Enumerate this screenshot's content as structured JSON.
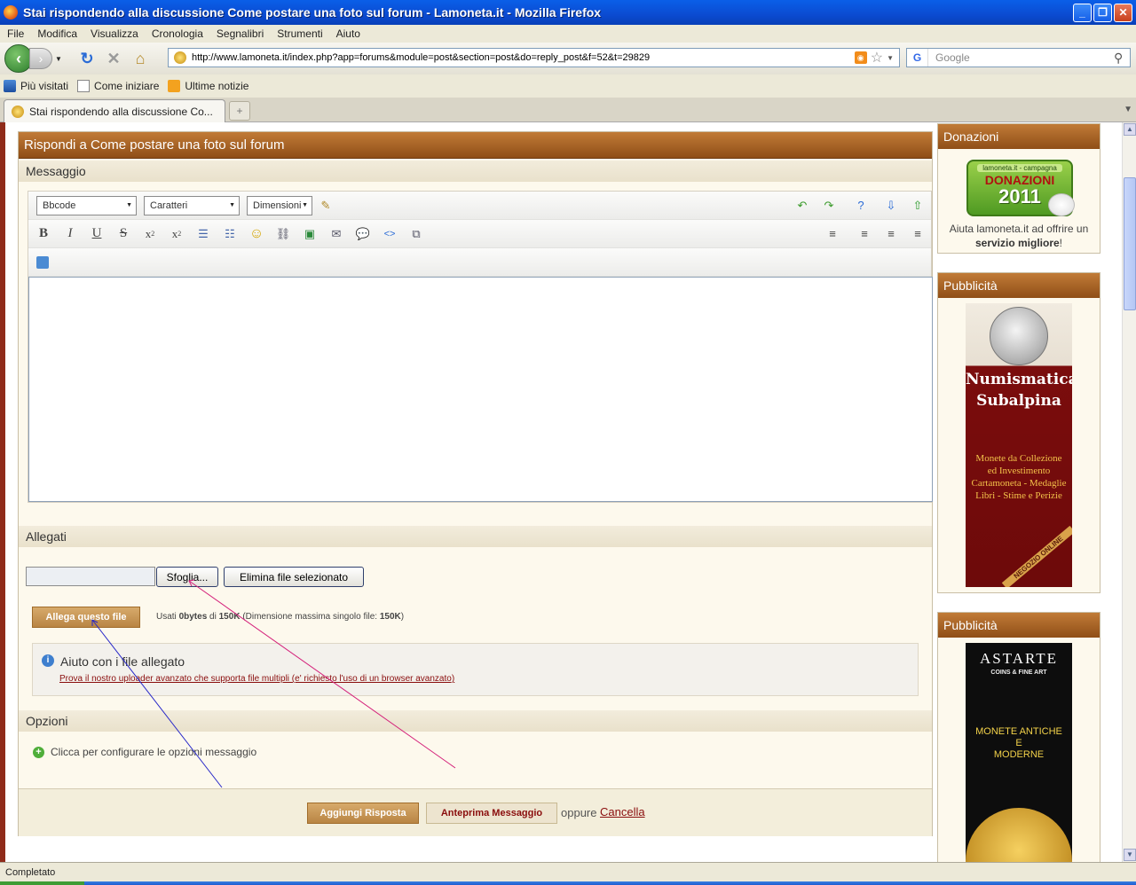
{
  "window": {
    "title": "Stai rispondendo alla discussione Come postare una foto sul forum - Lamoneta.it - Mozilla Firefox"
  },
  "menu": [
    "File",
    "Modifica",
    "Visualizza",
    "Cronologia",
    "Segnalibri",
    "Strumenti",
    "Aiuto"
  ],
  "nav": {
    "url": "http://www.lamoneta.it/index.php?app=forums&module=post&section=post&do=reply_post&f=52&t=29829",
    "search_placeholder": "Google"
  },
  "bookmarks": [
    "Più visitati",
    "Come iniziare",
    "Ultime notizie"
  ],
  "tab": {
    "label": "Stai rispondendo alla discussione Co..."
  },
  "main": {
    "header": "Rispondi a Come postare una foto sul forum",
    "message_section": "Messaggio",
    "editor": {
      "select_bbcode": "Bbcode",
      "select_font": "Caratteri",
      "select_size": "Dimensioni"
    },
    "attachments_section": "Allegati",
    "browse_button": "Sfoglia...",
    "remove_file_button": "Elimina file selezionato",
    "attach_button": "Allega questo file",
    "usage": {
      "prefix": "Usati",
      "used": "0bytes",
      "of": "di",
      "total": "150K",
      "max_label": "(Dimensione massima singolo file:",
      "max": "150K",
      "close": ")"
    },
    "help": {
      "title": "Aiuto con i file allegato",
      "link": "Prova il nostro uploader avanzato che supporta file multipli (e' richiesto l'uso di un browser avanzato)"
    },
    "options_section": "Opzioni",
    "options_toggle": "Clicca per configurare le opzioni messaggio",
    "submit_button": "Aggiungi Risposta",
    "preview_button": "Anteprima Messaggio",
    "or_text": "oppure",
    "cancel_link": "Cancella"
  },
  "sidebar": {
    "donations": {
      "title": "Donazioni",
      "badge_top": "lamoneta.it - campagna",
      "badge_main": "DONAZIONI",
      "badge_year": "2011",
      "text_prefix": "Aiuta lamoneta.it ad offrire un",
      "text_bold": "servizio migliore",
      "text_suffix": "!"
    },
    "ad1": {
      "title": "Pubblicità",
      "brand_line1": "Numismatica",
      "brand_line2": "Subalpina",
      "lines": [
        "Monete da Collezione",
        "ed Investimento",
        "Cartamoneta - Medaglie",
        "Libri - Stime e Perizie"
      ],
      "ribbon": "NEGOZIO ONLINE"
    },
    "ad2": {
      "title": "Pubblicità",
      "brand": "ASTARTE",
      "sub": "COINS & FINE ART",
      "lines": [
        "MONETE ANTICHE",
        "E",
        "MODERNE"
      ]
    }
  },
  "status": {
    "text": "Completato"
  },
  "colors": {
    "accent": "#a9641f",
    "link": "#8a0d0d",
    "arrow_pink": "#d4207a",
    "arrow_blue": "#2626c8"
  }
}
